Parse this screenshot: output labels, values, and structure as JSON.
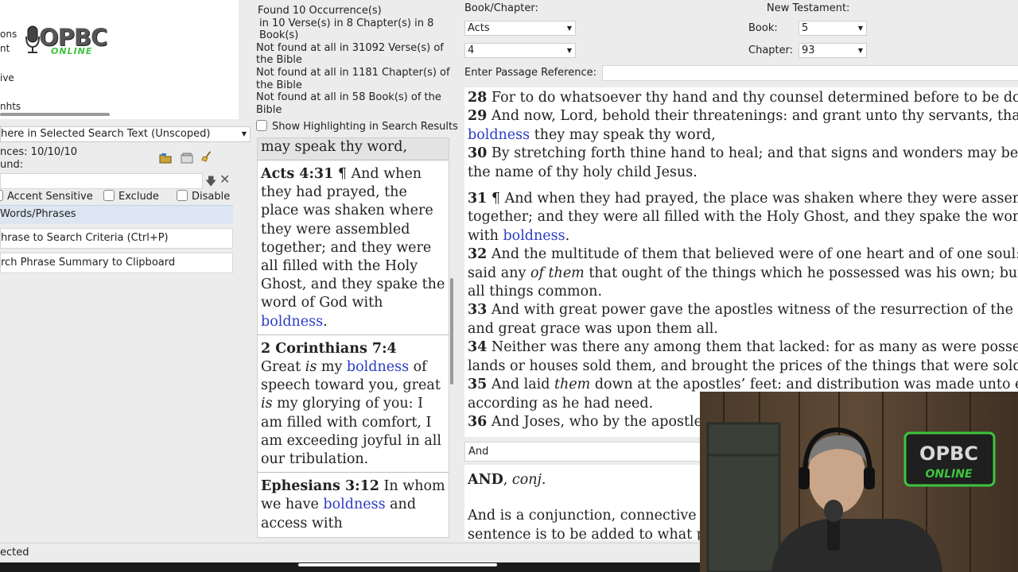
{
  "left": {
    "options": [
      "ons",
      "nt",
      "ive",
      "nhts"
    ],
    "logo": {
      "main": "OPBC",
      "sub": "ONLINE"
    },
    "scope_select": "here in Selected Search Text (Unscoped)",
    "occurrences": "nces: 10/10/10",
    "found": "und:",
    "checkboxes": {
      "accent": "Accent Sensitive",
      "exclude": "Exclude",
      "disable": "Disable"
    },
    "words_header": "Words/Phrases",
    "add_phrase_btn": "hrase to Search Criteria (Ctrl+P)",
    "copy_summary_btn": "rch Phrase Summary to Clipboard"
  },
  "middle": {
    "summary": [
      "Found 10 Occurrence(s)",
      "in 10 Verse(s) in 8 Chapter(s) in 8 Book(s)",
      "Not found at all in 31092 Verse(s) of the Bible",
      "Not found at all in 1181 Chapter(s) of the Bible",
      "Not found at all in 58 Book(s) of the Bible"
    ],
    "highlight_label": "Show Highlighting in Search Results",
    "partial_result": "may speak thy word,",
    "results": [
      {
        "ref": "Acts 4:31",
        "pre": " ¶ And when they had prayed, the place was shaken where they were assembled together; and they were all filled with the Holy Ghost, and they spake the word of God with ",
        "hit": "boldness",
        "post": "."
      },
      {
        "ref": "2 Corinthians 7:4",
        "pre": "Great ",
        "em1": "is",
        "mid1": " my ",
        "hit": "boldness",
        "mid2": " of speech toward you, great ",
        "em2": "is",
        "post": " my glorying of you: I am filled with comfort, I am exceeding joyful in all our tribulation."
      },
      {
        "ref": "Ephesians 3:12",
        "pre": " In whom we have ",
        "hit": "boldness",
        "post": " and access with"
      }
    ]
  },
  "right": {
    "book_chapter_label": "Book/Chapter:",
    "book_value": "Acts",
    "chapter_value": "4",
    "testament_label": "New Testament:",
    "book_label": "Book:",
    "book_num": "5",
    "chapter_label": "Chapter:",
    "chapter_num": "93",
    "passage_label": "Enter Passage Reference:",
    "verses": [
      {
        "n": "28",
        "t": " For to do whatsoever thy hand and thy counsel determined before to be done."
      },
      {
        "n": "29",
        "t": " And now, Lord, behold their threatenings: and grant unto thy servants, that with all"
      },
      {
        "n": "",
        "t": "",
        "hit": "boldness",
        "post": " they may speak thy word,"
      },
      {
        "n": "30",
        "t": " By stretching forth thine hand to heal; and that signs and wonders may be done by"
      },
      {
        "n": "",
        "t": "the name of thy holy child Jesus."
      },
      {
        "n": "31",
        "t": " ¶ And when they had prayed, the place was shaken where they were assembled"
      },
      {
        "n": "",
        "t": "together; and they were all filled with the Holy Ghost, and they spake the word of God"
      },
      {
        "n": "",
        "t": "with ",
        "hit": "boldness",
        "post": "."
      },
      {
        "n": "32",
        "t": " And the multitude of them that believed were of one heart and of one soul: neither"
      },
      {
        "n": "",
        "t": "said any ",
        "em": "of them",
        "post": " that ought of the things which he possessed was his own; but they had"
      },
      {
        "n": "",
        "t": "all things common."
      },
      {
        "n": "33",
        "t": " And with great power gave the apostles witness of the resurrection of the Lord Jesus:"
      },
      {
        "n": "",
        "t": "and great grace was upon them all."
      },
      {
        "n": "34",
        "t": " Neither was there any among them that lacked: for as many as were possessors of"
      },
      {
        "n": "",
        "t": "lands or houses sold them, and brought the prices of the things that were sold,"
      },
      {
        "n": "35",
        "t": " And laid ",
        "em": "them",
        "post": " down at the apostles’ feet: and distribution was made unto every man"
      },
      {
        "n": "",
        "t": "according as he had need."
      },
      {
        "n": "36",
        "t": " And Joses, who by the apostles was surnamed Barnabas,"
      }
    ],
    "dict_search": "And",
    "dict_head": "AND",
    "dict_pos": "conj.",
    "dict_body": "And is a conjunction, connective or joining word,",
    "dict_body2": "sentence is to be added to what precedes."
  },
  "status": "ected",
  "colors": {
    "highlight": "#2b3bc4",
    "logo_green": "#3ec43e"
  }
}
